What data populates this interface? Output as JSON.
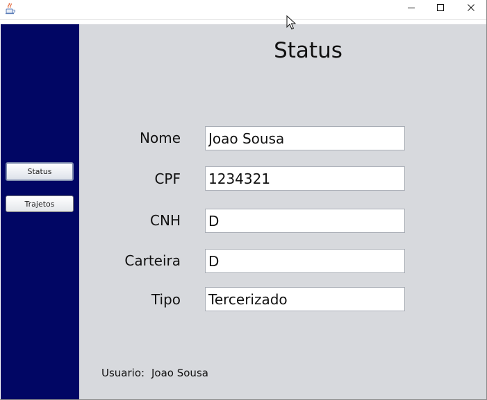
{
  "window": {
    "icons": {
      "app": "java-coffee-cup-icon",
      "minimize": "minimize-icon",
      "maximize": "maximize-icon",
      "close": "close-icon",
      "cursor": "mouse-pointer-icon"
    }
  },
  "sidebar": {
    "background": "#010664",
    "buttons": [
      {
        "label": "Status",
        "active": true
      },
      {
        "label": "Trajetos",
        "active": false
      }
    ]
  },
  "main": {
    "title": "Status",
    "background": "#d7d9dd",
    "fields": [
      {
        "label": "Nome",
        "value": "Joao Sousa"
      },
      {
        "label": "CPF",
        "value": "1234321"
      },
      {
        "label": "CNH",
        "value": "D"
      },
      {
        "label": "Carteira",
        "value": "D"
      },
      {
        "label": "Tipo",
        "value": "Tercerizado"
      }
    ],
    "footer": {
      "label": "Usuario:",
      "value": "Joao Sousa"
    }
  }
}
